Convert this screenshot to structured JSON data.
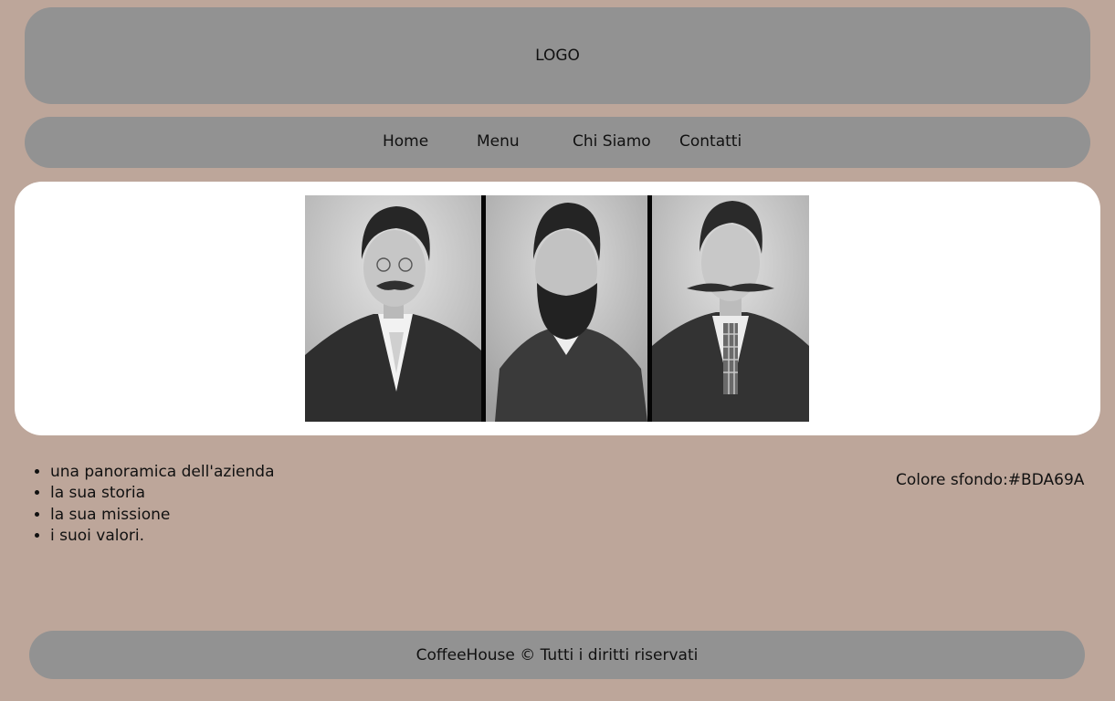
{
  "header": {
    "logo": "LOGO"
  },
  "nav": {
    "items": [
      {
        "label": "Home"
      },
      {
        "label": "Menu"
      },
      {
        "label": "Chi Siamo"
      },
      {
        "label": "Contatti"
      }
    ]
  },
  "hero": {
    "photos": [
      {
        "subject": "man-with-moustache-and-glasses"
      },
      {
        "subject": "man-with-full-beard"
      },
      {
        "subject": "man-with-moustache-and-plaid-tie"
      }
    ]
  },
  "main": {
    "list": [
      "una panoramica dell'azienda",
      "la sua storia",
      "la sua missione",
      "i suoi valori."
    ],
    "note": "Colore sfondo:#BDA69A"
  },
  "footer": {
    "text": "CoffeeHouse © Tutti i diritti riservati"
  },
  "colors": {
    "background": "#BDA69A",
    "panel": "#929292",
    "hero": "#FFFFFF"
  }
}
